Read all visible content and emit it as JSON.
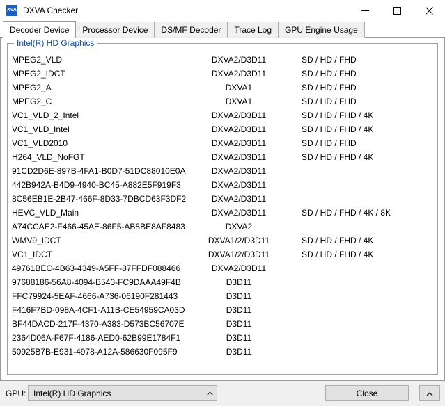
{
  "window": {
    "title": "DXVA Checker",
    "icon": "app-icon-xva",
    "icon_text": "XVA",
    "controls": {
      "minimize": "minimize-icon",
      "maximize": "maximize-icon",
      "close": "close-icon"
    }
  },
  "tabs": [
    {
      "label": "Decoder Device",
      "active": true
    },
    {
      "label": "Processor Device",
      "active": false
    },
    {
      "label": "DS/MF Decoder",
      "active": false
    },
    {
      "label": "Trace Log",
      "active": false
    },
    {
      "label": "GPU Engine Usage",
      "active": false
    }
  ],
  "group": {
    "label": "Intel(R) HD Graphics",
    "label_color": "#0b4e9e"
  },
  "decoders": [
    {
      "name": "MPEG2_VLD",
      "api": "DXVA2/D3D11",
      "resolutions": "SD / HD / FHD"
    },
    {
      "name": "MPEG2_IDCT",
      "api": "DXVA2/D3D11",
      "resolutions": "SD / HD / FHD"
    },
    {
      "name": "MPEG2_A",
      "api": "DXVA1",
      "resolutions": "SD / HD / FHD"
    },
    {
      "name": "MPEG2_C",
      "api": "DXVA1",
      "resolutions": "SD / HD / FHD"
    },
    {
      "name": "VC1_VLD_2_Intel",
      "api": "DXVA2/D3D11",
      "resolutions": "SD / HD / FHD / 4K"
    },
    {
      "name": "VC1_VLD_Intel",
      "api": "DXVA2/D3D11",
      "resolutions": "SD / HD / FHD / 4K"
    },
    {
      "name": "VC1_VLD2010",
      "api": "DXVA2/D3D11",
      "resolutions": "SD / HD / FHD"
    },
    {
      "name": "H264_VLD_NoFGT",
      "api": "DXVA2/D3D11",
      "resolutions": "SD / HD / FHD / 4K"
    },
    {
      "name": "91CD2D6E-897B-4FA1-B0D7-51DC88010E0A",
      "api": "DXVA2/D3D11",
      "resolutions": ""
    },
    {
      "name": "442B942A-B4D9-4940-BC45-A882E5F919F3",
      "api": "DXVA2/D3D11",
      "resolutions": ""
    },
    {
      "name": "8C56EB1E-2B47-466F-8D33-7DBCD63F3DF2",
      "api": "DXVA2/D3D11",
      "resolutions": ""
    },
    {
      "name": "HEVC_VLD_Main",
      "api": "DXVA2/D3D11",
      "resolutions": "SD / HD / FHD / 4K / 8K"
    },
    {
      "name": "A74CCAE2-F466-45AE-86F5-AB8BE8AF8483",
      "api": "DXVA2",
      "resolutions": ""
    },
    {
      "name": "WMV9_IDCT",
      "api": "DXVA1/2/D3D11",
      "resolutions": "SD / HD / FHD / 4K"
    },
    {
      "name": "VC1_IDCT",
      "api": "DXVA1/2/D3D11",
      "resolutions": "SD / HD / FHD / 4K"
    },
    {
      "name": "49761BEC-4B63-4349-A5FF-87FFDF088466",
      "api": "DXVA2/D3D11",
      "resolutions": ""
    },
    {
      "name": "97688186-56A8-4094-B543-FC9DAAA49F4B",
      "api": "D3D11",
      "resolutions": ""
    },
    {
      "name": "FFC79924-5EAF-4666-A736-06190F281443",
      "api": "D3D11",
      "resolutions": ""
    },
    {
      "name": "F416F7BD-098A-4CF1-A11B-CE54959CA03D",
      "api": "D3D11",
      "resolutions": ""
    },
    {
      "name": "BF44DACD-217F-4370-A383-D573BC56707E",
      "api": "D3D11",
      "resolutions": ""
    },
    {
      "name": "2364D06A-F67F-4186-AED0-62B99E1784F1",
      "api": "D3D11",
      "resolutions": ""
    },
    {
      "name": "50925B7B-E931-4978-A12A-586630F095F9",
      "api": "D3D11",
      "resolutions": ""
    }
  ],
  "bottom": {
    "gpu_label": "GPU:",
    "gpu_selected": "Intel(R) HD Graphics",
    "gpu_arrow": "chevron-up-icon",
    "close_label": "Close",
    "expand_arrow": "chevron-up-icon"
  }
}
